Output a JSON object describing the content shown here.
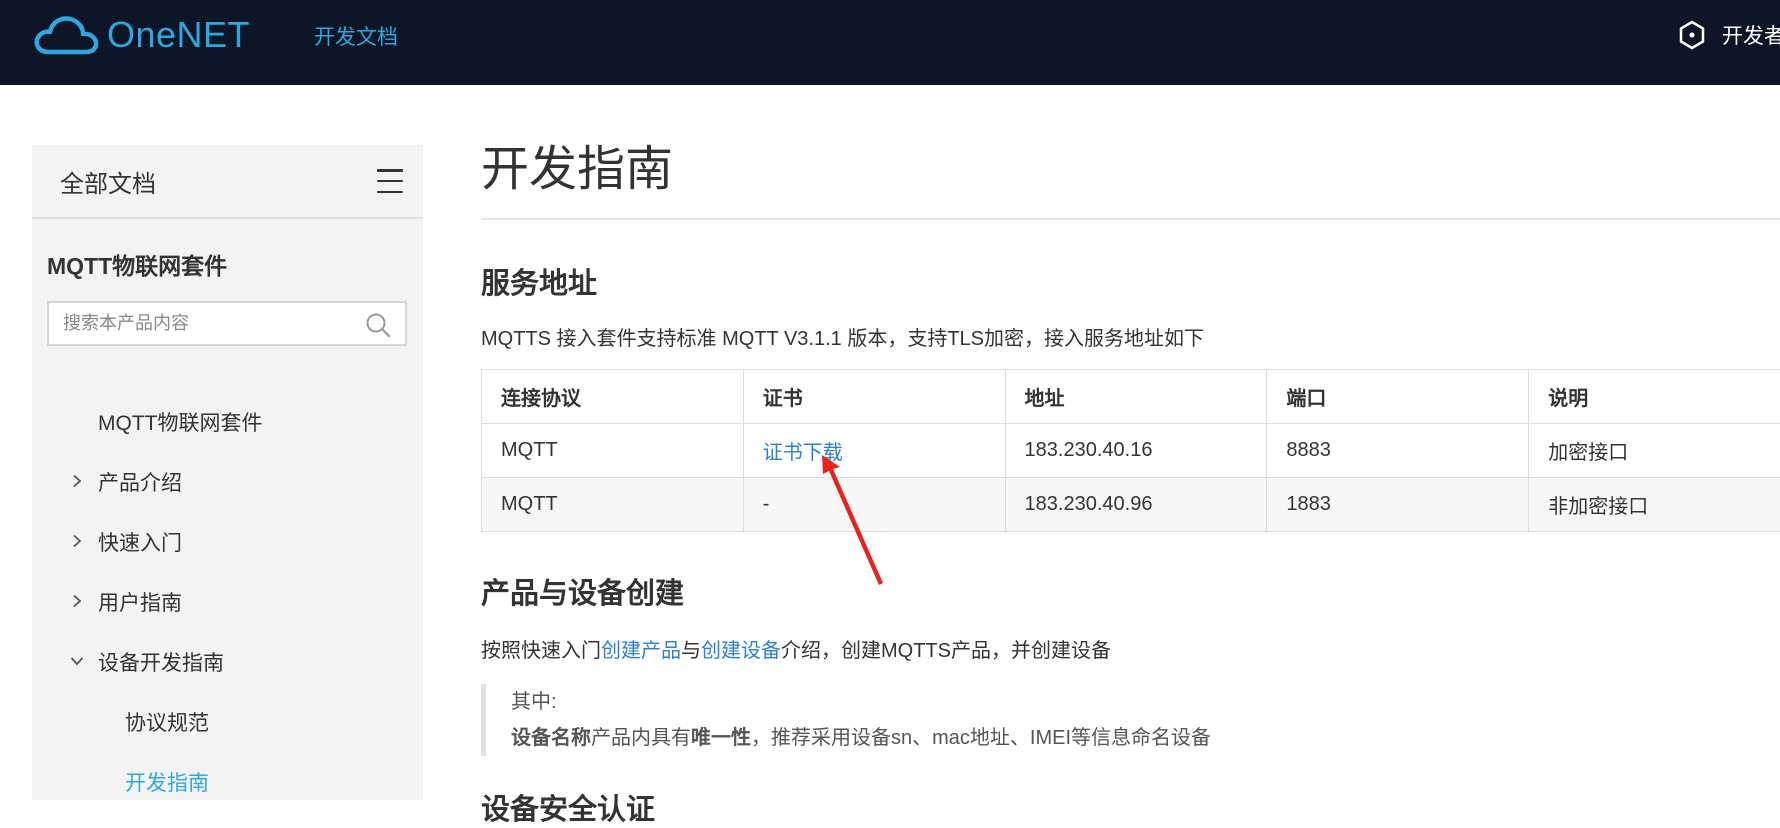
{
  "header": {
    "logo_text": "OneNET",
    "nav_docs": "开发文档",
    "right_text": "开发者",
    "brand_color": "#2ea7e0",
    "bg_color": "#0d1626"
  },
  "sidebar": {
    "title": "全部文档",
    "product": "MQTT物联网套件",
    "search_placeholder": "搜索本产品内容",
    "items": [
      {
        "label": "MQTT物联网套件",
        "chevron": "none"
      },
      {
        "label": "产品介绍",
        "chevron": "chevron-right"
      },
      {
        "label": "快速入门",
        "chevron": "chevron-right"
      },
      {
        "label": "用户指南",
        "chevron": "chevron-right"
      },
      {
        "label": "设备开发指南",
        "chevron": "chevron-down"
      },
      {
        "label": "协议规范",
        "chevron": "none"
      },
      {
        "label": "开发指南",
        "chevron": "none",
        "active": true
      }
    ]
  },
  "main": {
    "title": "开发指南",
    "section1": {
      "heading": "服务地址",
      "intro": "MQTTS 接入套件支持标准 MQTT V3.1.1 版本，支持TLS加密，接入服务地址如下",
      "table": {
        "headers": [
          "连接协议",
          "证书",
          "地址",
          "端口",
          "说明"
        ],
        "rows": [
          [
            "MQTT",
            "证书下载",
            "183.230.40.16",
            "8883",
            "加密接口"
          ],
          [
            "MQTT",
            "-",
            "183.230.40.96",
            "1883",
            "非加密接口"
          ]
        ]
      }
    },
    "section2": {
      "heading": "产品与设备创建",
      "step_prefix": "按照快速入门",
      "link1": "创建产品",
      "mid": "与",
      "link2": "创建设备",
      "step_suffix": "介绍，创建MQTTS产品，并创建设备",
      "note_label": "其中:",
      "note_b1": "设备名称",
      "note_t1": "产品内具有",
      "note_b2": "唯一性",
      "note_t2": "，推荐采用设备sn、mac地址、IMEI等信息命名设备"
    },
    "section3": {
      "heading": "设备安全认证"
    }
  },
  "annotation": {
    "arrow_color": "#e8231e"
  }
}
